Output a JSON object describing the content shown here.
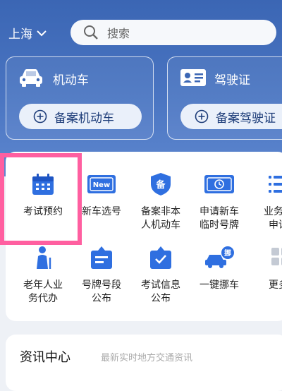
{
  "header": {
    "city": "上海",
    "search_placeholder": "搜索"
  },
  "cards": [
    {
      "title": "机动车",
      "action": "备案机动车"
    },
    {
      "title": "驾驶证",
      "action": "备案驾驶证"
    }
  ],
  "services": [
    {
      "label": "考试预约",
      "icon": "calendar-icon"
    },
    {
      "label": "新车选号",
      "icon": "new-plate-icon"
    },
    {
      "label": "备案非本\n人机动车",
      "icon": "shield-icon"
    },
    {
      "label": "申请新车\n临时号牌",
      "icon": "temp-plate-icon"
    },
    {
      "label": "业务预\n申请",
      "icon": "list-icon"
    },
    {
      "label": "老年人业\n务代办",
      "icon": "elder-icon"
    },
    {
      "label": "号牌号段\n公布",
      "icon": "plate-segment-icon"
    },
    {
      "label": "考试信息\n公布",
      "icon": "exam-info-icon"
    },
    {
      "label": "一键挪车",
      "icon": "move-car-icon"
    },
    {
      "label": "更多",
      "icon": "more-icon"
    }
  ],
  "news": {
    "title": "资讯中心",
    "subtitle": "最新实时地方交通资讯"
  },
  "colors": {
    "header_bg": "#3b66b4",
    "accent": "#2f6fe0",
    "highlight": "#ff5fa0"
  }
}
